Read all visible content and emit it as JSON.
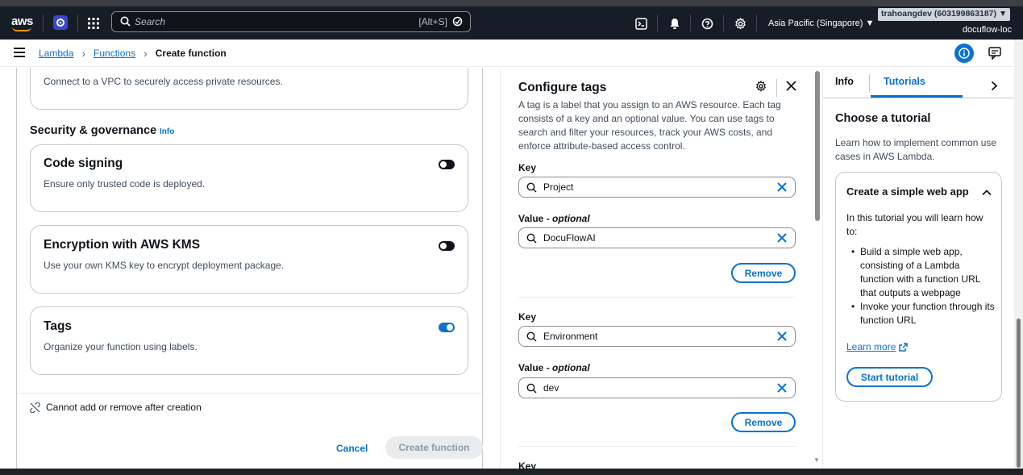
{
  "topnav": {
    "logo_text": "aws",
    "search_placeholder": "Search",
    "search_shortcut": "[Alt+S]",
    "region": "Asia Pacific (Singapore) ▼",
    "account": "trahoangdev (603199863187) ▼",
    "account_sub": "docuflow-loc",
    "icons": [
      "cloudshell-icon",
      "bell-icon",
      "help-icon",
      "settings-icon"
    ]
  },
  "breadcrumb": {
    "items": [
      "Lambda",
      "Functions"
    ],
    "current": "Create function"
  },
  "main": {
    "vpc_desc": "Connect to a VPC to securely access private resources.",
    "security_heading": "Security & governance",
    "security_info": "Info",
    "cards": [
      {
        "title": "Code signing",
        "desc": "Ensure only trusted code is deployed.",
        "enabled": false
      },
      {
        "title": "Encryption with AWS KMS",
        "desc": "Use your own KMS key to encrypt deployment package.",
        "enabled": false
      },
      {
        "title": "Tags",
        "desc": "Organize your function using labels.",
        "enabled": true
      }
    ],
    "note": "Cannot add or remove after creation",
    "cancel_label": "Cancel",
    "create_label": "Create function"
  },
  "tags_panel": {
    "title": "Configure tags",
    "description": "A tag is a label that you assign to an AWS resource. Each tag consists of a key and an optional value. You can use tags to search and filter your resources, track your AWS costs, and enforce attribute-based access control.",
    "key_label": "Key",
    "value_label_main": "Value - ",
    "value_label_opt": "optional",
    "remove_label": "Remove",
    "tags": [
      {
        "key": "Project",
        "value": "DocuFlowAI"
      },
      {
        "key": "Environment",
        "value": "dev"
      }
    ],
    "next_key_label": "Key"
  },
  "help_panel": {
    "tab_info": "Info",
    "tab_tutorials": "Tutorials",
    "heading": "Choose a tutorial",
    "intro": "Learn how to implement common use cases in AWS Lambda.",
    "tutorial": {
      "title": "Create a simple web app",
      "lead": "In this tutorial you will learn how to:",
      "bullets": [
        "Build a simple web app, consisting of a Lambda function with a function URL that outputs a webpage",
        "Invoke your function through its function URL"
      ],
      "learn_more": "Learn more",
      "start_label": "Start tutorial"
    }
  },
  "colors": {
    "nav_bg": "#161d26",
    "link_blue": "#0972d3",
    "aws_orange": "#ff9900"
  }
}
